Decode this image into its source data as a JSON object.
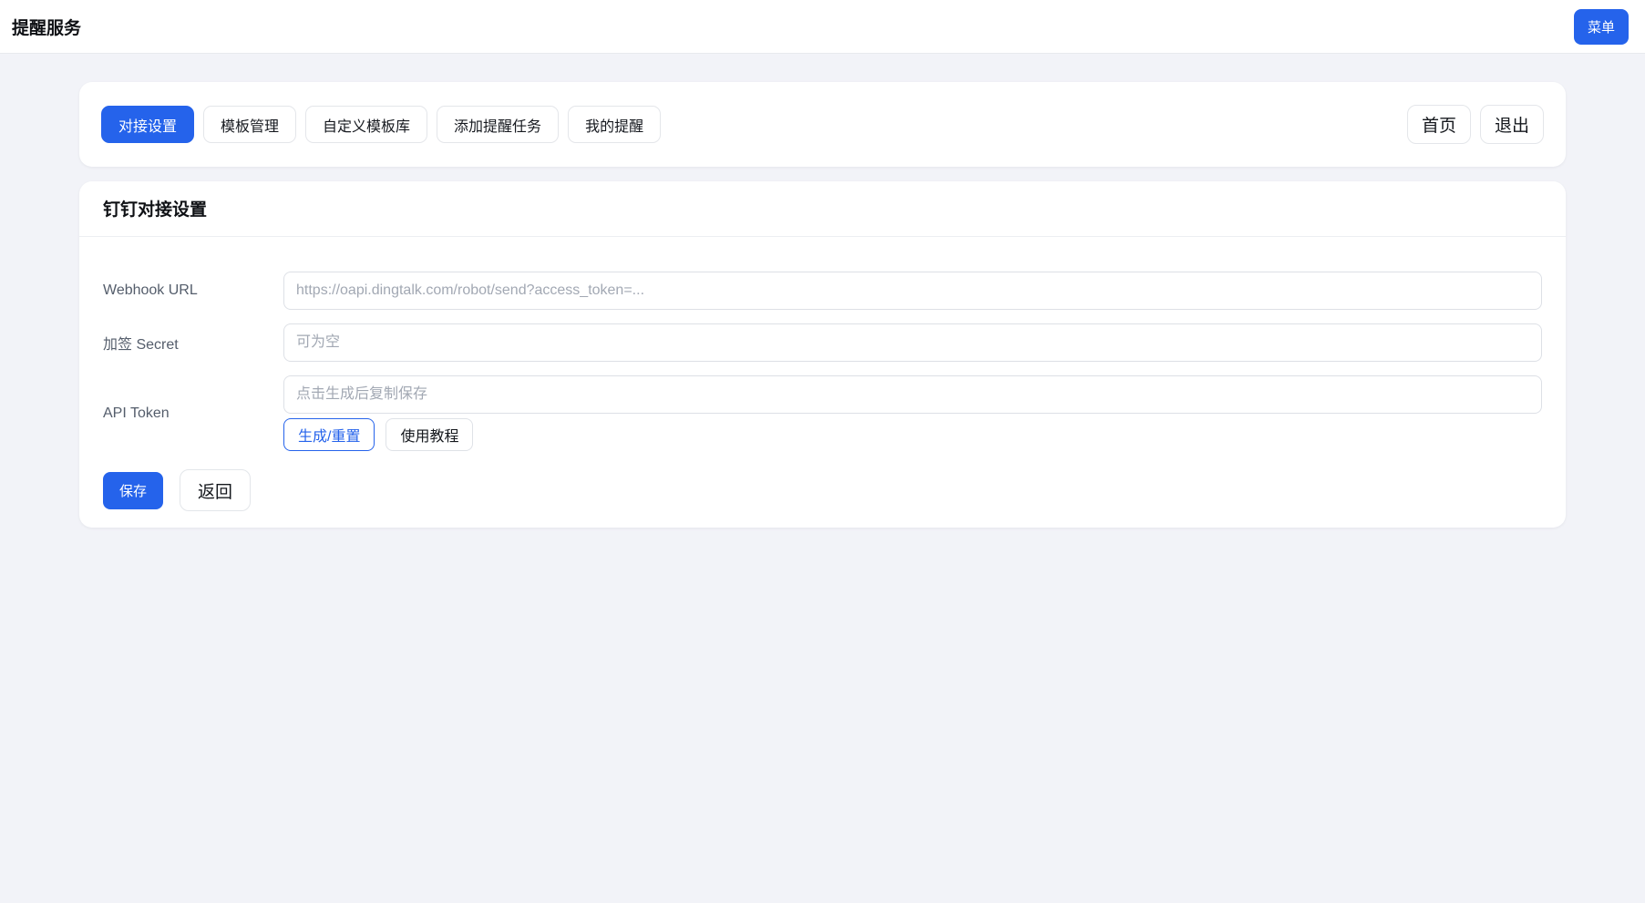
{
  "topbar": {
    "title": "提醒服务",
    "menu_button": "菜单"
  },
  "tabbar": {
    "tabs": [
      {
        "label": "对接设置",
        "active": true
      },
      {
        "label": "模板管理",
        "active": false
      },
      {
        "label": "自定义模板库",
        "active": false
      },
      {
        "label": "添加提醒任务",
        "active": false
      },
      {
        "label": "我的提醒",
        "active": false
      }
    ],
    "right_buttons": {
      "home": "首页",
      "logout": "退出"
    }
  },
  "settings_card": {
    "title": "钉钉对接设置",
    "fields": [
      {
        "label": "Webhook URL",
        "value": "",
        "placeholder": "https://oapi.dingtalk.com/robot/send?access_token=..."
      },
      {
        "label": "加签 Secret",
        "value": "",
        "placeholder": "可为空"
      },
      {
        "label": "API Token",
        "value": "",
        "placeholder": "点击生成后复制保存",
        "generate_button": "生成/重置",
        "tutorial_button": "使用教程"
      }
    ],
    "actions": {
      "save": "保存",
      "back": "返回"
    }
  },
  "colors": {
    "accent_blue": "#2563eb",
    "page_background": "#f2f3f8",
    "card_background": "#ffffff"
  }
}
